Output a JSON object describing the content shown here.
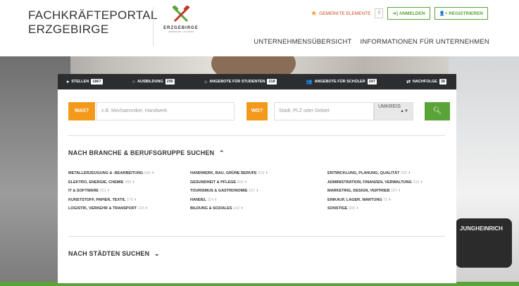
{
  "header": {
    "brand_line1": "FACHKRÄFTEPORTAL",
    "brand_line2": "ERZGEBIRGE",
    "logo_text": "ERZGEBIRGE",
    "logo_sub": "GEMEINSAM · WACHSEN",
    "watchlist_label": "GEMERKTE ELEMENTE",
    "watchlist_count": "0",
    "login_label": "ANMELDEN",
    "register_label": "REGISTRIEREN",
    "nav": [
      "UNTERNEHMENSÜBERSICHT",
      "INFORMATIONEN FÜR UNTERNEHMEN"
    ]
  },
  "tabs": [
    {
      "label": "STELLEN",
      "count": "1867",
      "icon": "radio-filled-icon"
    },
    {
      "label": "AUSBILDUNG",
      "count": "295",
      "icon": "radio-empty-icon"
    },
    {
      "label": "ANGEBOTE FÜR STUDENTEN",
      "count": "218",
      "icon": "graduation-icon"
    },
    {
      "label": "ANGEBOTE FÜR SCHÜLER",
      "count": "247",
      "icon": "users-icon"
    },
    {
      "label": "NACHFOLGE",
      "count": "38",
      "icon": "handshake-icon"
    }
  ],
  "search": {
    "what_label": "WAS?",
    "what_placeholder": "z.B. Mechatroniker, Handwerk",
    "where_label": "WO?",
    "where_placeholder": "Stadt, PLZ oder Gebiet",
    "radius_label": "UMKREIS",
    "submit_icon": "search-icon"
  },
  "categories_section": {
    "title": "NACH BRANCHE & BERUFSGRUPPE SUCHEN",
    "columns": [
      [
        {
          "name": "METALLERZEUGUNG & -BEARBEITUNG",
          "count": "643"
        },
        {
          "name": "ELEKTRO, ENERGIE, CHEMIE",
          "count": "365"
        },
        {
          "name": "IT & SOFTWARE",
          "count": "251"
        },
        {
          "name": "KUNSTSTOFF, PAPIER, TEXTIL",
          "count": "170"
        },
        {
          "name": "LOGISTIK, VERKEHR & TRANSPORT",
          "count": "123"
        }
      ],
      [
        {
          "name": "HANDWERK, BAU, GRÜNE BERUFE",
          "count": "419"
        },
        {
          "name": "GESUNDHEIT & PFLEGE",
          "count": "402"
        },
        {
          "name": "TOURISMUS & GASTRONOMIE",
          "count": "107"
        },
        {
          "name": "HANDEL",
          "count": "114"
        },
        {
          "name": "BILDUNG & SOZIALES",
          "count": "142"
        }
      ],
      [
        {
          "name": "ENTWICKLUNG, PLANUNG, QUALITÄT",
          "count": "292"
        },
        {
          "name": "ADMINISTRATION, FINANZEN, VERWALTUNG",
          "count": "215"
        },
        {
          "name": "MARKETING, DESIGN, VERTRIEB",
          "count": "107"
        },
        {
          "name": "EINKAUF, LAGER, WARTUNG",
          "count": "73"
        },
        {
          "name": "SONSTIGE",
          "count": "335"
        }
      ]
    ]
  },
  "cities_section": {
    "title": "NACH STÄDTEN SUCHEN"
  },
  "hero": {
    "machine_label": "JUNGHEINRICH"
  },
  "colors": {
    "accent_green": "#5aa339",
    "accent_orange": "#f39a1d",
    "tab_bar": "#2b2d2f"
  }
}
